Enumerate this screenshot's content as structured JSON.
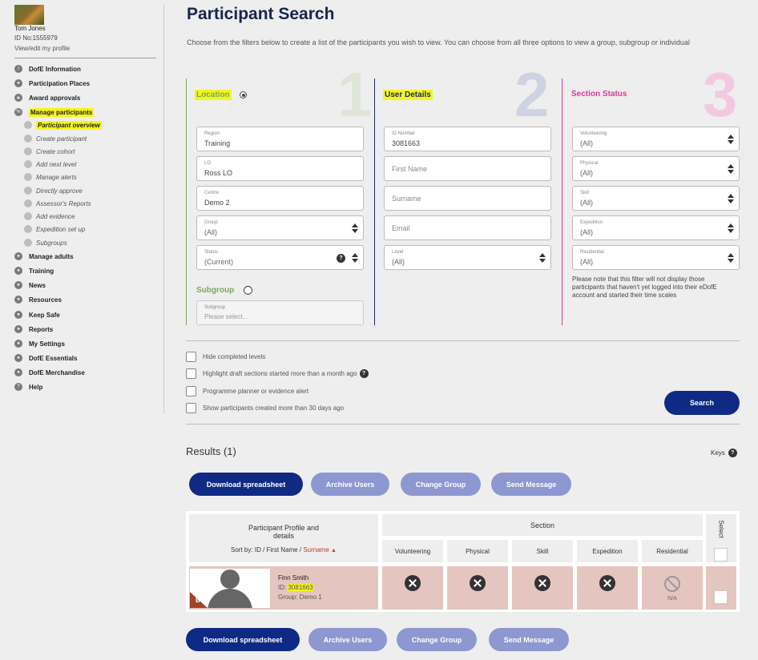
{
  "user": {
    "name": "Tom Jones",
    "id_text": "ID No:1555979",
    "profile_link": "View/edit my profile"
  },
  "sidebar": {
    "items": [
      {
        "label": "DofE Information",
        "icon": "info-icon"
      },
      {
        "label": "Participation Places",
        "icon": "places-icon"
      },
      {
        "label": "Award approvals",
        "icon": "award-icon"
      },
      {
        "label": "Manage participants",
        "icon": "participants-icon",
        "highlighted": true
      }
    ],
    "sub_items": [
      {
        "label": "Participant overview",
        "active": true
      },
      {
        "label": "Create participant"
      },
      {
        "label": "Create cohort"
      },
      {
        "label": "Add next level"
      },
      {
        "label": "Manage alerts"
      },
      {
        "label": "Directly approve"
      },
      {
        "label": "Assessor's Reports"
      },
      {
        "label": "Add evidence"
      },
      {
        "label": "Expedition set up"
      },
      {
        "label": "Subgroups"
      }
    ],
    "more_items": [
      {
        "label": "Manage adults"
      },
      {
        "label": "Training"
      },
      {
        "label": "News"
      },
      {
        "label": "Resources"
      },
      {
        "label": "Keep Safe"
      },
      {
        "label": "Reports"
      },
      {
        "label": "My Settings"
      },
      {
        "label": "DofE Essentials"
      },
      {
        "label": "DofE Merchandise"
      },
      {
        "label": "Help"
      }
    ]
  },
  "page": {
    "title": "Participant Search",
    "intro": "Choose from the filters below to create a list of the participants you wish to view. You can choose from all three options to view a group, subgroup or individual"
  },
  "filters": {
    "location": {
      "title": "Location",
      "number": "1",
      "color": "#7aa85a",
      "region": {
        "label": "Region",
        "value": "Training"
      },
      "lo": {
        "label": "LO",
        "value": "Ross LO"
      },
      "centre": {
        "label": "Centre",
        "value": "Demo 2"
      },
      "group": {
        "label": "Group",
        "value": "(All)"
      },
      "status": {
        "label": "Status",
        "value": "(Current)"
      },
      "subgroup_title": "Subgroup",
      "subgroup": {
        "label": "Subgroup",
        "placeholder": "Please select..."
      }
    },
    "user_details": {
      "title": "User Details",
      "number": "2",
      "color": "#1a2a7a",
      "id_number": {
        "label": "ID Number",
        "value": "3081663"
      },
      "first_name": {
        "placeholder": "First Name"
      },
      "surname": {
        "placeholder": "Surname"
      },
      "email": {
        "placeholder": "Email"
      },
      "level": {
        "label": "Level",
        "value": "(All)"
      }
    },
    "section_status": {
      "title": "Section Status",
      "number": "3",
      "color": "#e0399a",
      "volunteering": {
        "label": "Volunteering",
        "value": "(All)"
      },
      "physical": {
        "label": "Physical",
        "value": "(All)"
      },
      "skill": {
        "label": "Skill",
        "value": "(All)"
      },
      "expedition": {
        "label": "Expedition",
        "value": "(All)"
      },
      "residential": {
        "label": "Residential",
        "value": "(All)"
      },
      "note": "Please note that this filter will not display those participants that haven't yet logged into their eDofE account and started their time scales"
    }
  },
  "options": {
    "hide_completed": "Hide completed levels",
    "highlight_draft": "Highlight draft sections started more than a month ago",
    "planner_alert": "Programme planner or evidence alert",
    "created_30": "Show participants created more than 30 days ago"
  },
  "search_button": "Search",
  "results": {
    "title": "Results (1)",
    "keys": "Keys",
    "actions": {
      "download": "Download spreadsheet",
      "archive": "Archive Users",
      "change_group": "Change Group",
      "send_message": "Send Message"
    },
    "table": {
      "profile_header": "Participant Profile and details",
      "sort_by": "Sort by:",
      "sort_id": "ID",
      "sort_first": "First Name",
      "sort_surname": "Surname",
      "section_header": "Section",
      "select_header": "Select",
      "columns": [
        "Volunteering",
        "Physical",
        "Skill",
        "Expedition",
        "Residential"
      ],
      "rows": [
        {
          "name": "Finn Smith",
          "id_prefix": "ID:",
          "id": "3081663",
          "group": "Group: Demo 1",
          "badge": "B",
          "statuses": [
            "cross",
            "cross",
            "cross",
            "cross",
            "na"
          ],
          "na_label": "N/A"
        }
      ]
    }
  },
  "colors": {
    "navy": "#17264f",
    "button_dark": "#0e2a84",
    "button_light": "#8d97d0",
    "highlight": "#f5f51a",
    "row_bg": "#e5c5bf"
  }
}
